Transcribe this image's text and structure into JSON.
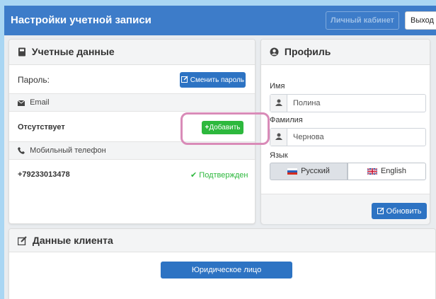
{
  "header": {
    "title": "Настройки учетной записи",
    "cabinet_label": "Личный кабинет",
    "exit_label": "Выход"
  },
  "account": {
    "title": "Учетные данные",
    "password_label": "Пароль:",
    "change_password_label": "Сменить пароль",
    "email_section": "Email",
    "email_value": "Отсутствует",
    "add_label": "Добавить",
    "phone_section": "Мобильный телефон",
    "phone_value": "+79233013478",
    "phone_status": "Подтвержден"
  },
  "profile": {
    "title": "Профиль",
    "first_name_label": "Имя",
    "first_name_placeholder": "Полина",
    "last_name_label": "Фамилия",
    "last_name_placeholder": "Чернова",
    "language_label": "Язык",
    "lang_ru": "Русский",
    "lang_en": "English",
    "update_label": "Обновить"
  },
  "client": {
    "title": "Данные клиента",
    "legal_entity_label": "Юридическое лицо"
  },
  "colors": {
    "header_bg": "#3d7cc9",
    "primary": "#2d73c3",
    "success": "#2db83d",
    "highlight": "#d98bb8"
  },
  "icons": [
    "book-icon",
    "pencil-square-icon",
    "envelope-icon",
    "phone-icon",
    "plus-icon",
    "check-icon",
    "user-circle-icon",
    "user-icon",
    "edit-icon",
    "flag-ru-icon",
    "flag-gb-icon"
  ]
}
